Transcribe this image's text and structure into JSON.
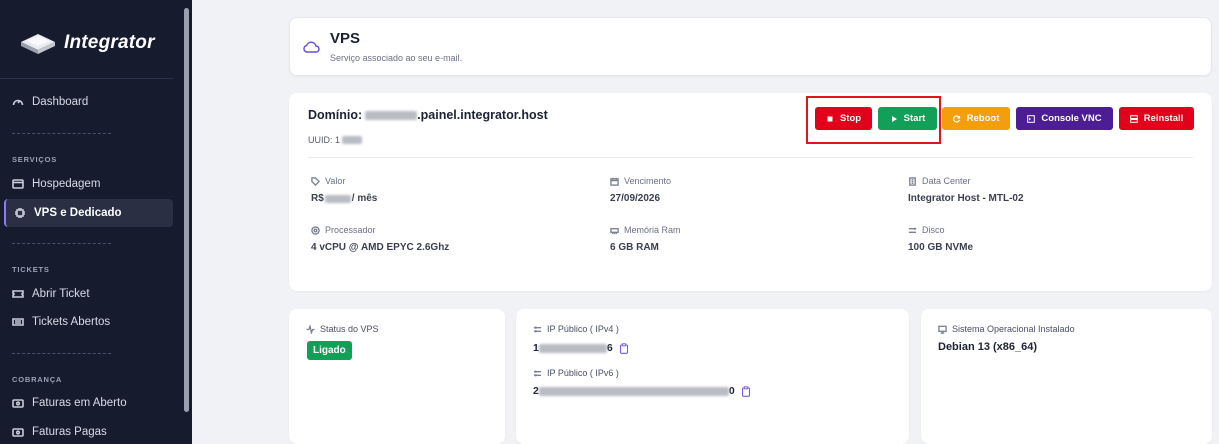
{
  "brand": {
    "name": "Integrator"
  },
  "sidebar": {
    "dashboard": "Dashboard",
    "sections": {
      "servicos": "SERVIÇOS",
      "tickets": "TICKETS",
      "cobranca": "COBRANÇA"
    },
    "items": {
      "hospedagem": "Hospedagem",
      "vps": "VPS e Dedicado",
      "abrir_ticket": "Abrir Ticket",
      "tickets_abertos": "Tickets Abertos",
      "faturas_aberto": "Faturas em Aberto",
      "faturas_pagas": "Faturas Pagas"
    },
    "active": "VPS e Dedicado"
  },
  "header": {
    "title": "VPS",
    "subtitle": "Serviço associado ao seu e-mail."
  },
  "service": {
    "domain_label": "Domínio:",
    "domain_suffix": ".painel.integrator.host",
    "uuid_label": "UUID: 1",
    "actions": {
      "stop": "Stop",
      "start": "Start",
      "reboot": "Reboot",
      "console": "Console VNC",
      "reinstall": "Reinstall"
    },
    "specs": {
      "valor": {
        "label": "Valor",
        "value_prefix": "R$",
        "value_suffix": "/ mês"
      },
      "vencimento": {
        "label": "Vencimento",
        "value": "27/09/2026"
      },
      "datacenter": {
        "label": "Data Center",
        "value": "Integrator Host - MTL-02"
      },
      "processador": {
        "label": "Processador",
        "value": "4 vCPU @ AMD EPYC 2.6Ghz"
      },
      "memoria": {
        "label": "Memória Ram",
        "value": "6 GB RAM"
      },
      "disco": {
        "label": "Disco",
        "value": "100 GB NVMe"
      }
    }
  },
  "status": {
    "label": "Status do VPS",
    "value": "Ligado"
  },
  "network": {
    "ipv4_label": "IP Público ( IPv4 )",
    "ipv4_start": "1",
    "ipv4_end": "6",
    "ipv6_label": "IP Público ( IPv6 )",
    "ipv6_start": "2",
    "ipv6_end": "0"
  },
  "os": {
    "label": "Sistema Operacional Instalado",
    "value": "Debian 13 (x86_64)"
  },
  "colors": {
    "sidebar_bg": "#161b2e",
    "stop": "#e3001b",
    "start": "#12a058",
    "reboot": "#f59e0b",
    "console": "#4c1d95",
    "reinstall": "#e3001b",
    "status_on": "#12a058",
    "accent": "#8b7cf6"
  }
}
